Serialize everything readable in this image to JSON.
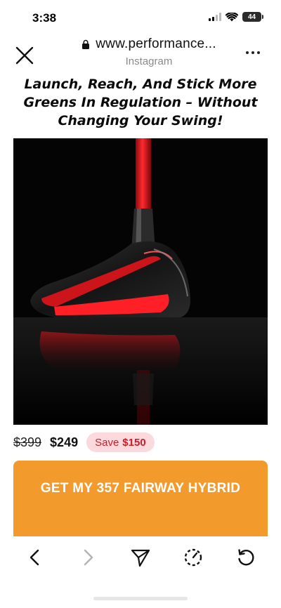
{
  "status_bar": {
    "time": "3:38",
    "battery": "44",
    "icons": [
      "signal-icon",
      "wifi-icon",
      "battery-icon"
    ]
  },
  "browser": {
    "url": "www.performance...",
    "source": "Instagram",
    "icons": [
      "close-icon",
      "lock-icon",
      "more-icon"
    ]
  },
  "ad": {
    "headline": "Launch, Reach, And Stick More Greens In Regulation – Without Changing Your Swing!",
    "image_subject": "golf-hybrid-club",
    "old_price": "$399",
    "new_price": "$249",
    "save_label": "Save",
    "save_amount": "$150",
    "cta_label": "GET MY 357 FAIRWAY HYBRID"
  },
  "toolbar": {
    "icons": [
      "back-icon",
      "forward-icon",
      "share-icon",
      "timer-icon",
      "refresh-icon"
    ]
  },
  "colors": {
    "cta": "#f39a2c",
    "save_badge_bg": "#fbd9dc",
    "save_badge_text": "#c81e2a",
    "club_accent": "#e0141b"
  }
}
